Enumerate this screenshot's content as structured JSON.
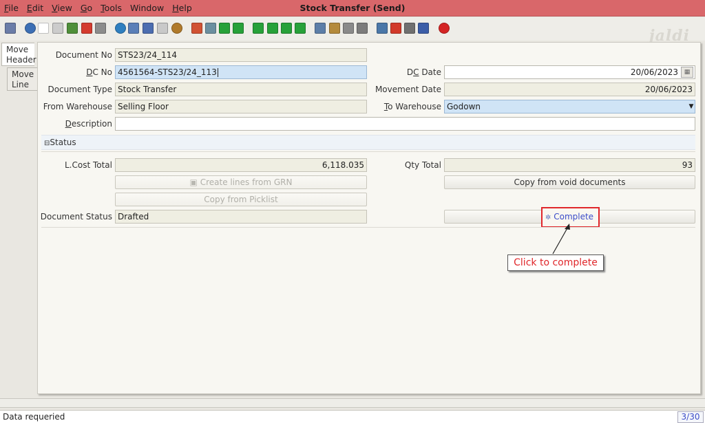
{
  "window": {
    "title": "Stock Transfer (Send)"
  },
  "menu": [
    {
      "key": "F",
      "rest": "ile"
    },
    {
      "key": "E",
      "rest": "dit"
    },
    {
      "key": "V",
      "rest": "iew"
    },
    {
      "key": "G",
      "rest": "o"
    },
    {
      "key": "T",
      "rest": "ools"
    },
    {
      "key": "",
      "rest": "Window"
    },
    {
      "key": "H",
      "rest": "elp"
    }
  ],
  "toolbar": {
    "icons": [
      "undo-icon",
      "help-icon",
      "new-icon",
      "copy-icon",
      "save-new-icon",
      "delete-icon",
      "save-icon",
      "refresh-icon",
      "find-icon",
      "attachment-icon",
      "chat-icon",
      "history-icon",
      "home-icon",
      "menu-icon",
      "back-icon",
      "forward-icon",
      "first-record-icon",
      "previous-record-icon",
      "next-record-icon",
      "last-record-icon",
      "report-icon",
      "archive-icon",
      "print-preview-icon",
      "print-icon",
      "zoom-across-icon",
      "request-icon",
      "product-info-icon",
      "workflow-icon",
      "close-window-icon"
    ],
    "colors": [
      "#6b7da8",
      "#3c6fb5",
      "#ffffff",
      "#cccccc",
      "#4f8f3a",
      "#d43b2f",
      "#8c8c8c",
      "#2f7fc0",
      "#5a7fb8",
      "#4c6db0",
      "#c9c9c9",
      "#b07a2c",
      "#d15234",
      "#6c8fa0",
      "#27a13a",
      "#27a13a",
      "#27a13a",
      "#27a13a",
      "#27a13a",
      "#27a13a",
      "#5c7ea8",
      "#b48a3c",
      "#8a8a8a",
      "#7c7c7c",
      "#4a77a8",
      "#d23a2a",
      "#707070",
      "#3c5ea8",
      "#d42424"
    ],
    "logo": "jaldi"
  },
  "tabs": {
    "header": "Move Header",
    "line": "Move Line"
  },
  "form": {
    "document_no_label": "Document No",
    "document_no": "STS23/24_114",
    "dc_no_label_pre": "",
    "dc_no_label_key": "D",
    "dc_no_label_rest": "C No",
    "dc_no": "4561564-STS23/24_113",
    "dc_date_label_key": "D",
    "dc_date_label_rest": "C Date",
    "dc_date": "20/06/2023",
    "document_type_label": "Document Type",
    "document_type": "Stock Transfer",
    "movement_date_label": "Movement Date",
    "movement_date": "20/06/2023",
    "from_warehouse_label": "From Warehouse",
    "from_warehouse": "Selling Floor",
    "to_warehouse_label_key": "T",
    "to_warehouse_label_rest": "o Warehouse",
    "to_warehouse": "Godown",
    "description_label_key": "D",
    "description_label_rest": "escription",
    "description": ""
  },
  "status": {
    "section_label": "Status",
    "lcost_total_label": "L.Cost Total",
    "lcost_total": "6,118.035",
    "qty_total_label": "Qty Total",
    "qty_total": "93",
    "create_lines_label": "Create lines from GRN",
    "copy_void_label": "Copy from void documents",
    "copy_picklist_label": "Copy from Picklist",
    "document_status_label": "Document Status",
    "document_status": "Drafted",
    "complete_label": "Complete"
  },
  "annotation": {
    "callout": "Click to complete"
  },
  "statusbar": {
    "message": "Data requeried",
    "record": "3/30"
  },
  "colors": {
    "titlebar": "#d9676a",
    "accent_blue": "#d0e4f6",
    "highlight_red": "#e0262a"
  }
}
